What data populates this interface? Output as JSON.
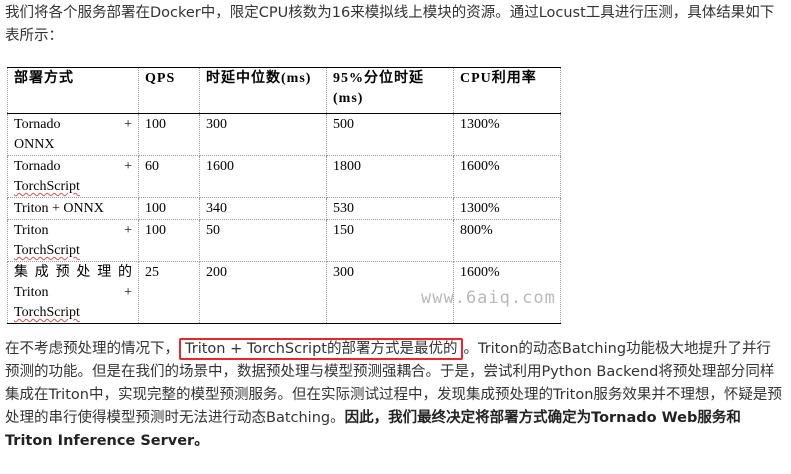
{
  "intro_text": "我们将各个服务部署在Docker中，限定CPU核数为16来模拟线上模块的资源。通过Locust工具进行压测，具体结果如下表所示：",
  "table": {
    "headers": [
      "部署方式",
      "QPS",
      "时延中位数(ms)",
      "95%分位时延(ms)",
      "CPU利用率"
    ],
    "rows": [
      {
        "method_line1": "Tornado +",
        "method_line2": "ONNX",
        "qps": "100",
        "median": "300",
        "p95": "500",
        "cpu": "1300%"
      },
      {
        "method_line1": "Tornado +",
        "method_line2": "TorchScript",
        "qps": "60",
        "median": "1600",
        "p95": "1800",
        "cpu": "1600%"
      },
      {
        "method_line1": "Triton + ONNX",
        "method_line2": "",
        "qps": "100",
        "median": "340",
        "p95": "530",
        "cpu": "1300%"
      },
      {
        "method_line1": "Triton +",
        "method_line2": "TorchScript",
        "qps": "100",
        "median": "50",
        "p95": "150",
        "cpu": "800%"
      },
      {
        "method_line1": "集成预处理的",
        "method_line2": "Triton +",
        "method_line3": "TorchScript",
        "qps": "25",
        "median": "200",
        "p95": "300",
        "cpu": "1600%"
      }
    ]
  },
  "watermark": "www.6aiq.com",
  "conclusion": {
    "before": "在不考虑预处理的情况下，",
    "highlight": "Triton + TorchScript的部署方式是最优的",
    "after": "。Triton的动态Batching功能极大地提升了并行预测的功能。但是在我们的场景中，数据预处理与模型预测强耦合。于是，尝试利用Python Backend将预处理部分同样集成在Triton中，实现完整的模型预测服务。但在实际测试过程中，发现集成预处理的Triton服务效果并不理想，怀疑是预处理的串行使得模型预测时无法进行动态Batching。",
    "bold": "因此，我们最终决定将部署方式确定为Tornado Web服务和Triton Inference Server。"
  },
  "colors": {
    "highlight_border": "#e8262b",
    "text": "#333333"
  }
}
